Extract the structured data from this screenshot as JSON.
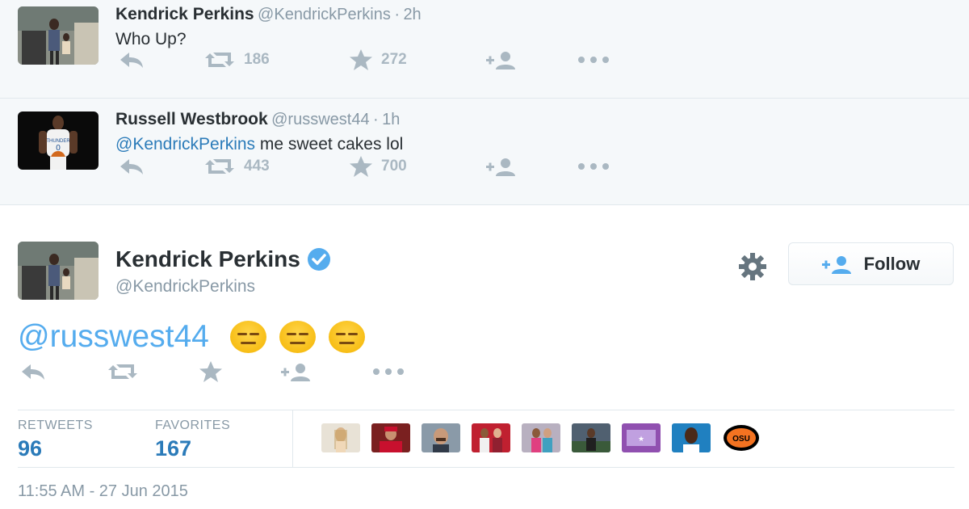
{
  "thread": [
    {
      "name": "Kendrick Perkins",
      "handle": "@KendrickPerkins",
      "time": "2h",
      "text": "Who Up?",
      "retweets": "186",
      "favorites": "272"
    },
    {
      "name": "Russell Westbrook",
      "handle": "@russwest44",
      "time": "1h",
      "mention": "@KendrickPerkins",
      "text": " me sweet cakes lol",
      "retweets": "443",
      "favorites": "700"
    }
  ],
  "main": {
    "name": "Kendrick Perkins",
    "handle": "@KendrickPerkins",
    "follow_label": "Follow",
    "text": "@russwest44",
    "emojis": [
      "expressionless-face",
      "expressionless-face",
      "expressionless-face"
    ],
    "stats": {
      "retweets_label": "RETWEETS",
      "retweets": "96",
      "favorites_label": "FAVORITES",
      "favorites": "167"
    },
    "timestamp": "11:55 AM - 27 Jun 2015"
  },
  "colors": {
    "link": "#2b7bb9",
    "mention_big": "#55acee",
    "muted": "#8899a6",
    "icon": "#aab8c2",
    "verified": "#55acee"
  }
}
